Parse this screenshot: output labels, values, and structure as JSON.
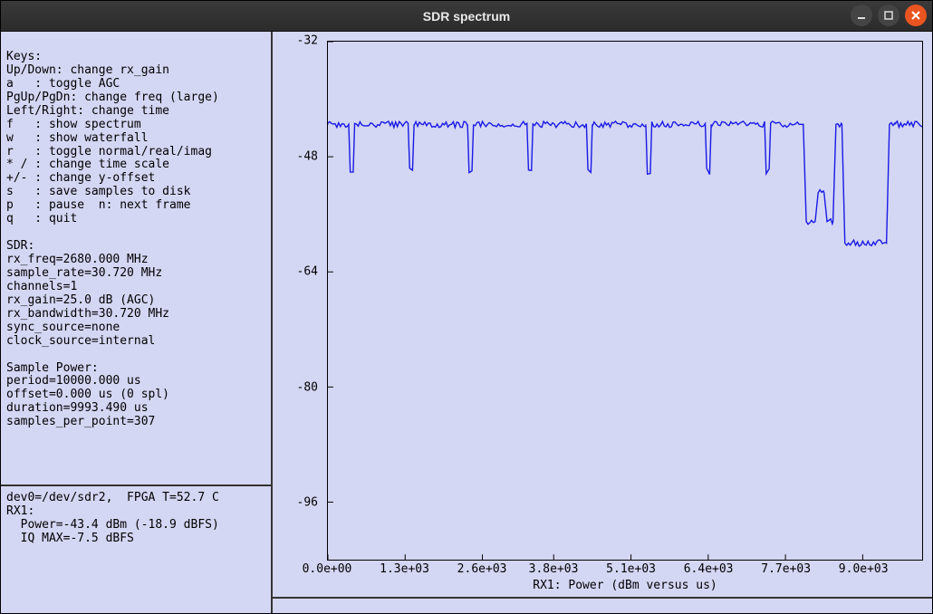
{
  "window": {
    "title": "SDR spectrum"
  },
  "left": {
    "text": "\nKeys:\nUp/Down: change rx_gain\na   : toggle AGC\nPgUp/PgDn: change freq (large)\nLeft/Right: change time\nf   : show spectrum\nw   : show waterfall\nr   : toggle normal/real/imag\n* / : change time scale\n+/- : change y-offset\ns   : save samples to disk\np   : pause  n: next frame\nq   : quit\n\nSDR:\nrx_freq=2680.000 MHz\nsample_rate=30.720 MHz\nchannels=1\nrx_gain=25.0 dB (AGC)\nrx_bandwidth=30.720 MHz\nsync_source=none\nclock_source=internal\n\nSample Power:\nperiod=10000.000 us\noffset=0.000 us (0 spl)\nduration=9993.490 us\nsamples_per_point=307",
    "status": "dev0=/dev/sdr2,  FPGA T=52.7 C\nRX1:\n  Power=-43.4 dBm (-18.9 dBFS)\n  IQ MAX=-7.5 dBFS"
  },
  "chart_data": {
    "type": "line",
    "title": "",
    "xlabel": "RX1: Power (dBm versus us)",
    "ylabel": "",
    "xlim": [
      0,
      10000
    ],
    "ylim": [
      -104,
      -32
    ],
    "x_ticks": [
      {
        "v": 0,
        "label": "0.0e+00"
      },
      {
        "v": 1300,
        "label": "1.3e+03"
      },
      {
        "v": 2600,
        "label": "2.6e+03"
      },
      {
        "v": 3800,
        "label": "3.8e+03"
      },
      {
        "v": 5100,
        "label": "5.1e+03"
      },
      {
        "v": 6400,
        "label": "6.4e+03"
      },
      {
        "v": 7700,
        "label": "7.7e+03"
      },
      {
        "v": 9000,
        "label": "9.0e+03"
      }
    ],
    "y_ticks": [
      {
        "v": -32,
        "label": "-32"
      },
      {
        "v": -48,
        "label": "-48"
      },
      {
        "v": -64,
        "label": "-64"
      },
      {
        "v": -80,
        "label": "-80"
      },
      {
        "v": -96,
        "label": "-96"
      }
    ],
    "series": [
      {
        "name": "RX1 Power",
        "color": "#1a1ae6",
        "segments": [
          {
            "x0": 0,
            "x1": 350,
            "y": -43.5
          },
          {
            "x0": 450,
            "x1": 1350,
            "y": -43.5
          },
          {
            "x0": 1450,
            "x1": 2350,
            "y": -43.5
          },
          {
            "x0": 2450,
            "x1": 3350,
            "y": -43.5
          },
          {
            "x0": 3450,
            "x1": 4350,
            "y": -43.5
          },
          {
            "x0": 4450,
            "x1": 5350,
            "y": -43.5
          },
          {
            "x0": 5450,
            "x1": 6350,
            "y": -43.5
          },
          {
            "x0": 6450,
            "x1": 7350,
            "y": -43.5
          },
          {
            "x0": 7450,
            "x1": 8000,
            "y": -43.5
          },
          {
            "x0": 9550,
            "x1": 10000,
            "y": -43.5
          }
        ],
        "dips": [
          350,
          1350,
          2350,
          3350,
          4350,
          5350,
          6350,
          7350
        ],
        "dip_depth": -50,
        "tail_profile": [
          {
            "x": 8000,
            "y": -43.5
          },
          {
            "x": 8050,
            "y": -57
          },
          {
            "x": 8200,
            "y": -57
          },
          {
            "x": 8250,
            "y": -53
          },
          {
            "x": 8350,
            "y": -53
          },
          {
            "x": 8400,
            "y": -57
          },
          {
            "x": 8500,
            "y": -57
          },
          {
            "x": 8550,
            "y": -43.5
          },
          {
            "x": 8650,
            "y": -43.5
          },
          {
            "x": 8700,
            "y": -60
          },
          {
            "x": 9400,
            "y": -60
          },
          {
            "x": 9450,
            "y": -43.5
          },
          {
            "x": 9550,
            "y": -43.5
          }
        ]
      }
    ]
  }
}
